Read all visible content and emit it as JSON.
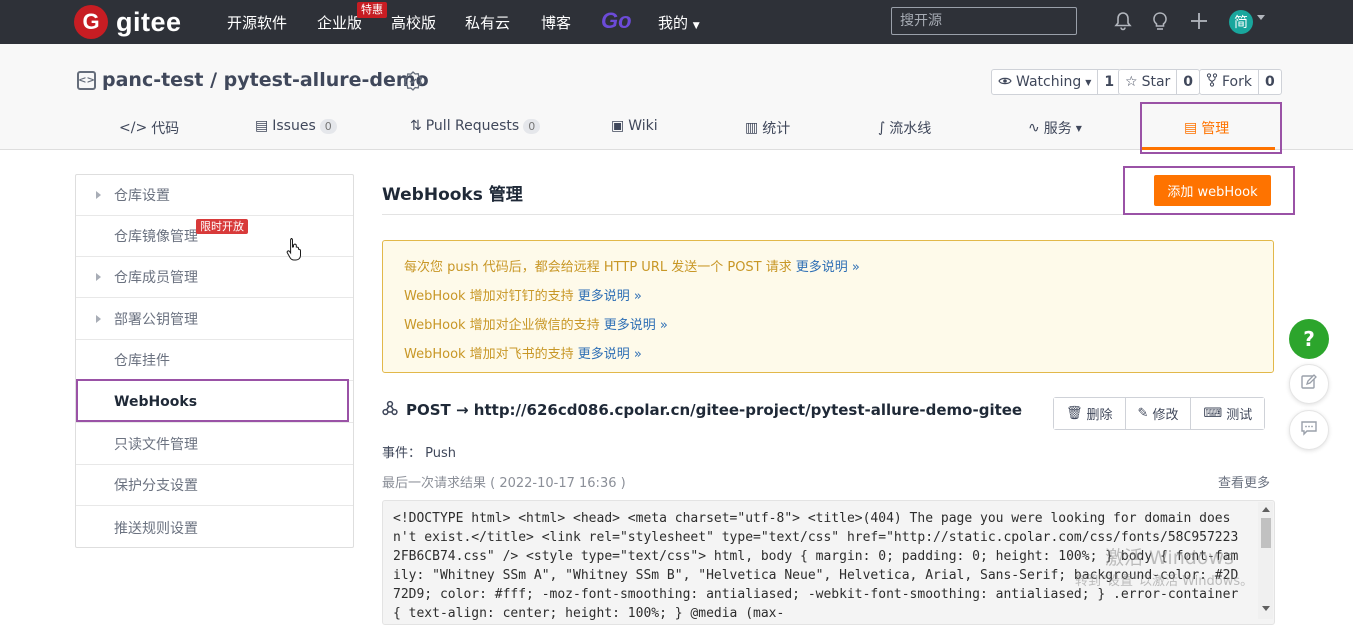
{
  "topnav": {
    "logo_mark": "G",
    "logo_text": "gitee",
    "links": [
      "开源软件",
      "企业版",
      "高校版",
      "私有云",
      "博客"
    ],
    "enterprise_badge": "特惠",
    "go_label": "Go",
    "mine_label": "我的",
    "search_placeholder": "搜开源",
    "avatar_text": "简"
  },
  "repo": {
    "title": "panc-test / pytest-allure-demo",
    "watching_label": "Watching",
    "watching_count": "1",
    "star_label": "Star",
    "star_count": "0",
    "fork_label": "Fork",
    "fork_count": "0"
  },
  "tabs": [
    {
      "label": "代码"
    },
    {
      "label": "Issues",
      "badge": "0"
    },
    {
      "label": "Pull Requests",
      "badge": "0"
    },
    {
      "label": "Wiki"
    },
    {
      "label": "统计"
    },
    {
      "label": "流水线"
    },
    {
      "label": "服务"
    },
    {
      "label": "管理"
    }
  ],
  "sidebar": {
    "items": [
      {
        "label": "仓库设置"
      },
      {
        "label": "仓库镜像管理"
      },
      {
        "label": "仓库成员管理"
      },
      {
        "label": "部署公钥管理"
      },
      {
        "label": "仓库挂件"
      },
      {
        "label": "WebHooks"
      },
      {
        "label": "只读文件管理"
      },
      {
        "label": "保护分支设置"
      },
      {
        "label": "推送规则设置"
      }
    ],
    "limited_badge": "限时开放"
  },
  "main": {
    "title": "WebHooks 管理",
    "add_button": "添加 webHook",
    "notices": [
      {
        "text": "每次您 push 代码后，都会给远程 HTTP URL 发送一个 POST 请求",
        "link": "更多说明 »"
      },
      {
        "text": "WebHook 增加对钉钉的支持",
        "link": "更多说明 »"
      },
      {
        "text": "WebHook 增加对企业微信的支持",
        "link": "更多说明 »"
      },
      {
        "text": "WebHook 增加对飞书的支持",
        "link": "更多说明 »"
      }
    ],
    "hook_url": "POST → http://626cd086.cpolar.cn/gitee-project/pytest-allure-demo-gitee",
    "delete_label": "删除",
    "edit_label": "修改",
    "test_label": "测试",
    "event_text": "事件：  Push",
    "last_result": "最后一次请求结果 ( 2022-10-17 16:36 )",
    "view_more": "查看更多",
    "response_body": "<!DOCTYPE html> <html> <head> <meta charset=\"utf-8\"> <title>(404) The page you were looking for domain doesn't exist.</title> <link rel=\"stylesheet\" type=\"text/css\" href=\"http://static.cpolar.com/css/fonts/58C9572232FB6CB74.css\" /> <style type=\"text/css\"> html, body { margin: 0; padding: 0; height: 100%; } body { font-family: \"Whitney SSm A\", \"Whitney SSm B\", \"Helvetica Neue\", Helvetica, Arial, Sans-Serif; background-color: #2D72D9; color: #fff; -moz-font-smoothing: antialiased; -webkit-font-smoothing: antialiased; } .error-container { text-align: center; height: 100%; } @media (max-"
  },
  "watermark": {
    "line1": "激活 Windows",
    "line2": "转到\"设置\"以激活 Windows。"
  },
  "help_label": "?"
}
